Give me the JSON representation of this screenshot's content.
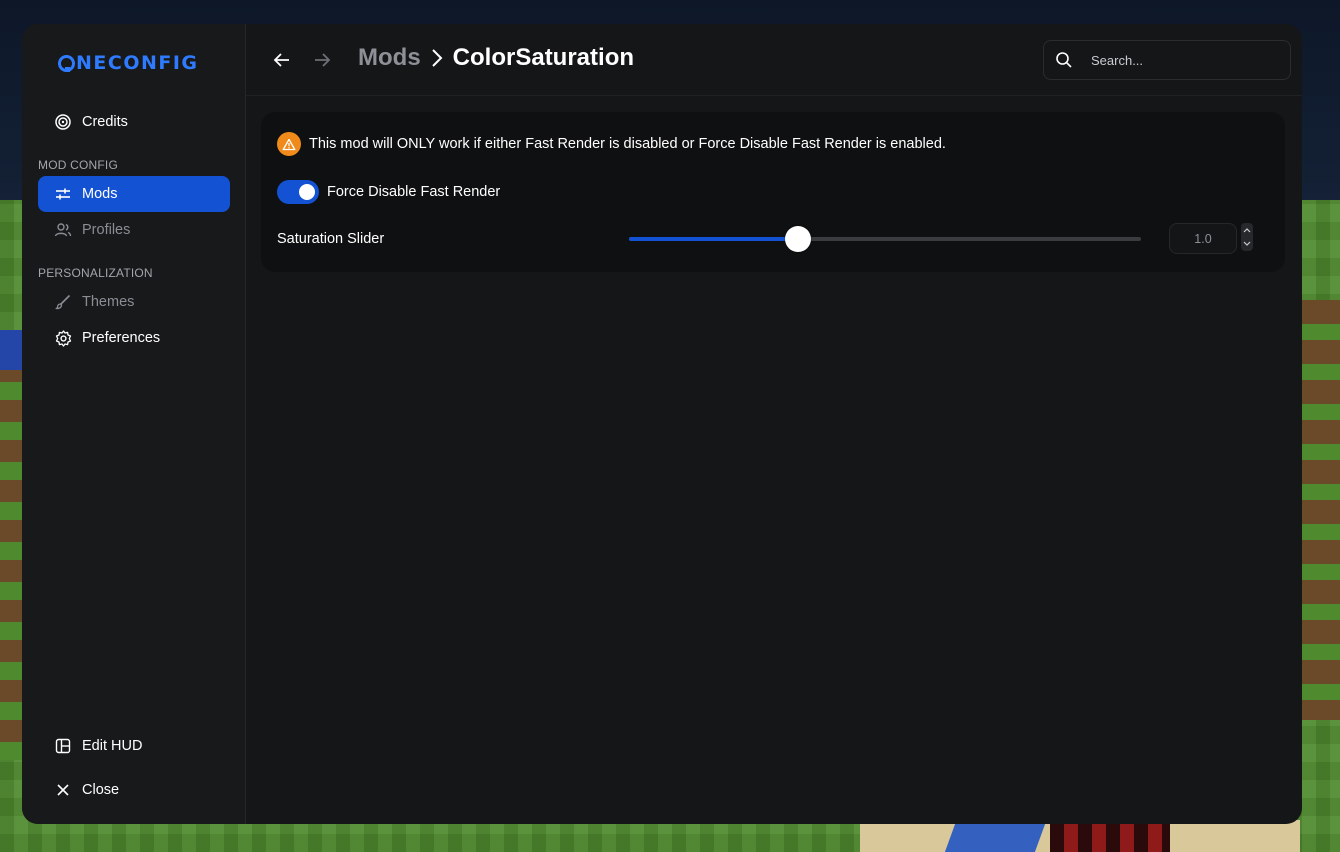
{
  "app": {
    "logo_text": "NECONFIG",
    "brand_color": "#2f7bff",
    "accent_color": "#1452d4",
    "warning_color": "#f08a1a"
  },
  "sidebar": {
    "credits_label": "Credits",
    "section_mod_config": "MOD CONFIG",
    "mods_label": "Mods",
    "profiles_label": "Profiles",
    "section_personalization": "PERSONALIZATION",
    "themes_label": "Themes",
    "preferences_label": "Preferences",
    "edit_hud_label": "Edit HUD",
    "close_label": "Close"
  },
  "header": {
    "breadcrumb_parent": "Mods",
    "breadcrumb_current": "ColorSaturation",
    "search_placeholder": "Search..."
  },
  "content": {
    "warning_text": "This mod will ONLY work if either Fast Render is disabled or Force Disable Fast Render is enabled.",
    "toggle_label": "Force Disable Fast Render",
    "toggle_on": true,
    "slider_label": "Saturation Slider",
    "slider_value": "1.0",
    "slider_fraction": 0.33
  }
}
